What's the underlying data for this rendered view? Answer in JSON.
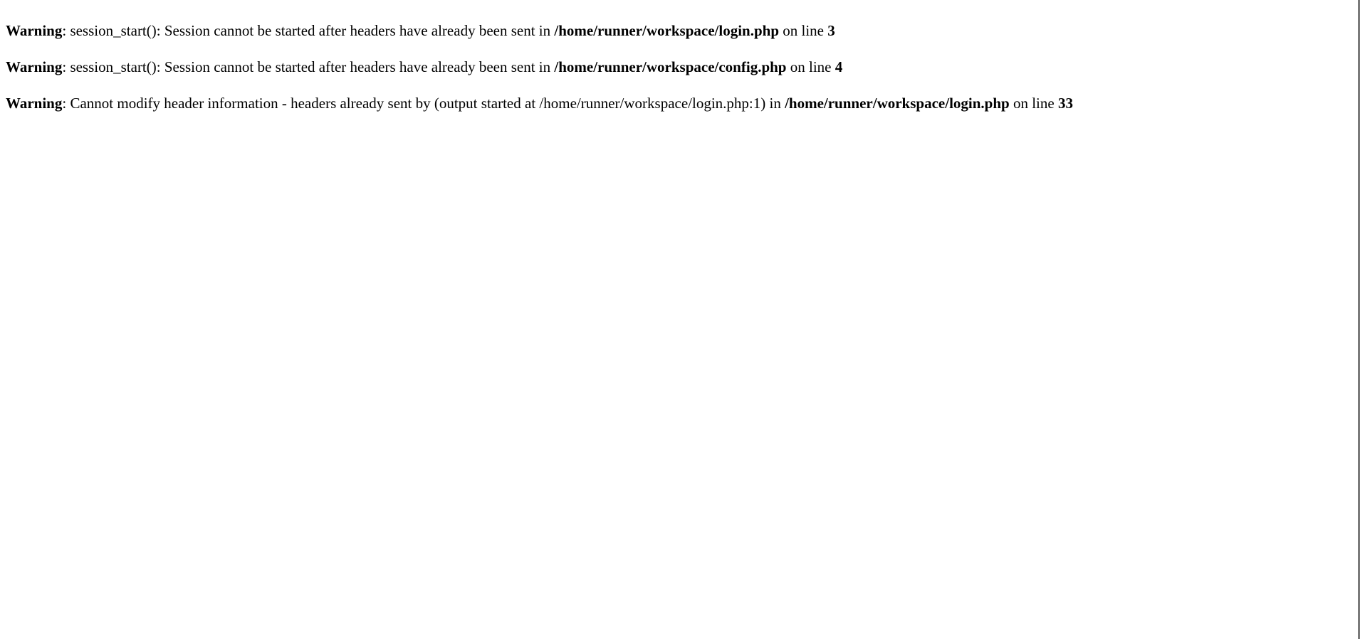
{
  "warnings": [
    {
      "label": "Warning",
      "message": ": session_start(): Session cannot be started after headers have already been sent in ",
      "file": "/home/runner/workspace/login.php",
      "on_line_text": " on line ",
      "line": "3"
    },
    {
      "label": "Warning",
      "message": ": session_start(): Session cannot be started after headers have already been sent in ",
      "file": "/home/runner/workspace/config.php",
      "on_line_text": " on line ",
      "line": "4"
    },
    {
      "label": "Warning",
      "message": ": Cannot modify header information - headers already sent by (output started at /home/runner/workspace/login.php:1) in ",
      "file": "/home/runner/workspace/login.php",
      "on_line_text": " on line ",
      "line": "33"
    }
  ]
}
